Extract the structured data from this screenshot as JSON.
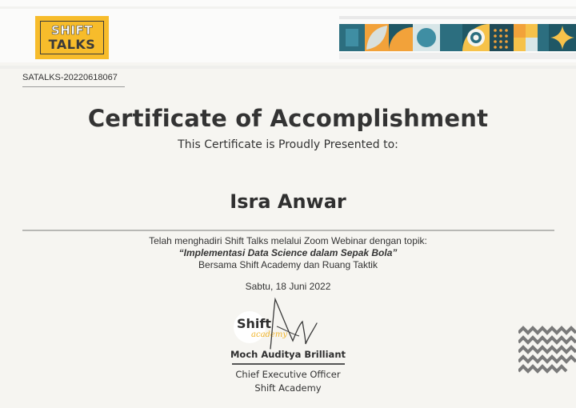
{
  "header": {
    "logo_line1": "SHIFT",
    "logo_line2": "TALKS"
  },
  "certificate": {
    "number": "SATALKS-20220618067",
    "title": "Certificate of Accomplishment",
    "subtitle": "This Certificate is Proudly Presented to:",
    "recipient": "Isra Anwar",
    "line1": "Telah menghadiri Shift Talks melalui Zoom Webinar dengan topik:",
    "topic": "“Implementasi Data Science dalam Sepak Bola”",
    "line3": "Bersama Shift Academy dan Ruang Taktik",
    "date": "Sabtu, 18 Juni 2022"
  },
  "signature": {
    "logo_word": "Shift",
    "logo_script": "academy",
    "signer_name": "Moch Auditya Brilliant",
    "role": "Chief Executive Officer",
    "organization": "Shift Academy"
  },
  "colors": {
    "accent_yellow": "#f7bc2b",
    "teal": "#2c6e7f",
    "text": "#333333"
  }
}
